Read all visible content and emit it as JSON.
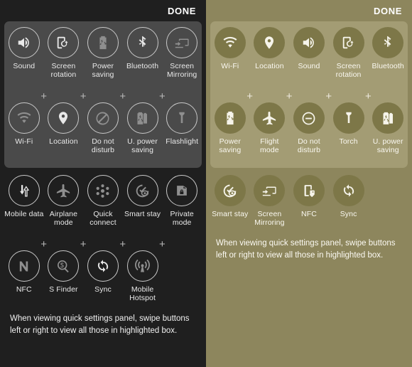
{
  "panels": [
    {
      "id": "dark-theme-panel",
      "theme": "dark",
      "done_label": "DONE",
      "hint_text": "When viewing quick settings panel, swipe buttons left or right to view all those in highlighted box.",
      "highlight_rows": [
        {
          "tiles": [
            {
              "label": "Sound",
              "icon": "sound-icon",
              "active": true
            },
            {
              "label": "Screen rotation",
              "icon": "screen-rotation-icon",
              "active": true
            },
            {
              "label": "Power saving",
              "icon": "power-saving-icon",
              "active": false
            },
            {
              "label": "Bluetooth",
              "icon": "bluetooth-icon",
              "active": true
            },
            {
              "label": "Screen Mirroring",
              "icon": "screen-mirroring-icon",
              "active": false
            }
          ]
        },
        {
          "tiles": [
            {
              "label": "Wi-Fi",
              "icon": "wifi-icon",
              "active": false
            },
            {
              "label": "Location",
              "icon": "location-icon",
              "active": true
            },
            {
              "label": "Do not disturb",
              "icon": "do-not-disturb-icon",
              "active": false
            },
            {
              "label": "U. power saving",
              "icon": "ultra-power-saving-icon",
              "active": false
            },
            {
              "label": "Flashlight",
              "icon": "flashlight-icon",
              "active": false
            }
          ]
        }
      ],
      "lower_rows": [
        {
          "tiles": [
            {
              "label": "Mobile data",
              "icon": "mobile-data-icon",
              "active": true
            },
            {
              "label": "Airplane mode",
              "icon": "airplane-mode-icon",
              "active": false
            },
            {
              "label": "Quick connect",
              "icon": "quick-connect-icon",
              "active": false
            },
            {
              "label": "Smart stay",
              "icon": "smart-stay-icon",
              "active": false
            },
            {
              "label": "Private mode",
              "icon": "private-mode-icon",
              "active": false
            }
          ]
        },
        {
          "tiles": [
            {
              "label": "NFC",
              "icon": "nfc-icon",
              "active": false
            },
            {
              "label": "S Finder",
              "icon": "s-finder-icon",
              "active": false
            },
            {
              "label": "Sync",
              "icon": "sync-icon",
              "active": true
            },
            {
              "label": "Mobile Hotspot",
              "icon": "mobile-hotspot-icon",
              "active": false
            }
          ]
        }
      ],
      "plus_label": "+"
    },
    {
      "id": "khaki-theme-panel",
      "theme": "khaki",
      "done_label": "DONE",
      "hint_text": "When viewing quick settings panel, swipe buttons left or right to view all those in highlighted box.",
      "highlight_rows": [
        {
          "tiles": [
            {
              "label": "Wi-Fi",
              "icon": "wifi-icon",
              "active": true
            },
            {
              "label": "Location",
              "icon": "location-icon",
              "active": true
            },
            {
              "label": "Sound",
              "icon": "sound-icon",
              "active": true
            },
            {
              "label": "Screen rotation",
              "icon": "screen-rotation-icon",
              "active": true
            },
            {
              "label": "Bluetooth",
              "icon": "bluetooth-icon",
              "active": true
            }
          ]
        },
        {
          "tiles": [
            {
              "label": "Power saving",
              "icon": "power-saving-icon",
              "active": true
            },
            {
              "label": "Flight mode",
              "icon": "airplane-mode-icon",
              "active": true
            },
            {
              "label": "Do not disturb",
              "icon": "do-not-disturb-icon",
              "active": true
            },
            {
              "label": "Torch",
              "icon": "flashlight-icon",
              "active": true
            },
            {
              "label": "U. power saving",
              "icon": "ultra-power-saving-icon",
              "active": true
            }
          ]
        }
      ],
      "lower_rows": [
        {
          "tiles": [
            {
              "label": "Smart stay",
              "icon": "smart-stay-icon",
              "active": true
            },
            {
              "label": "Screen Mirroring",
              "icon": "screen-mirroring-icon",
              "active": true
            },
            {
              "label": "NFC",
              "icon": "nfc-tag-icon",
              "active": true
            },
            {
              "label": "Sync",
              "icon": "sync-icon",
              "active": true
            }
          ]
        }
      ],
      "plus_label": "+"
    }
  ],
  "colors": {
    "dark_background": "#1f1f1f",
    "dark_highlight_box": "#4a4a4a",
    "khaki_background": "#8d865d",
    "khaki_highlight_box": "#a39c74",
    "khaki_button_fill": "#7d7748",
    "text_primary": "#f2f2f2"
  }
}
